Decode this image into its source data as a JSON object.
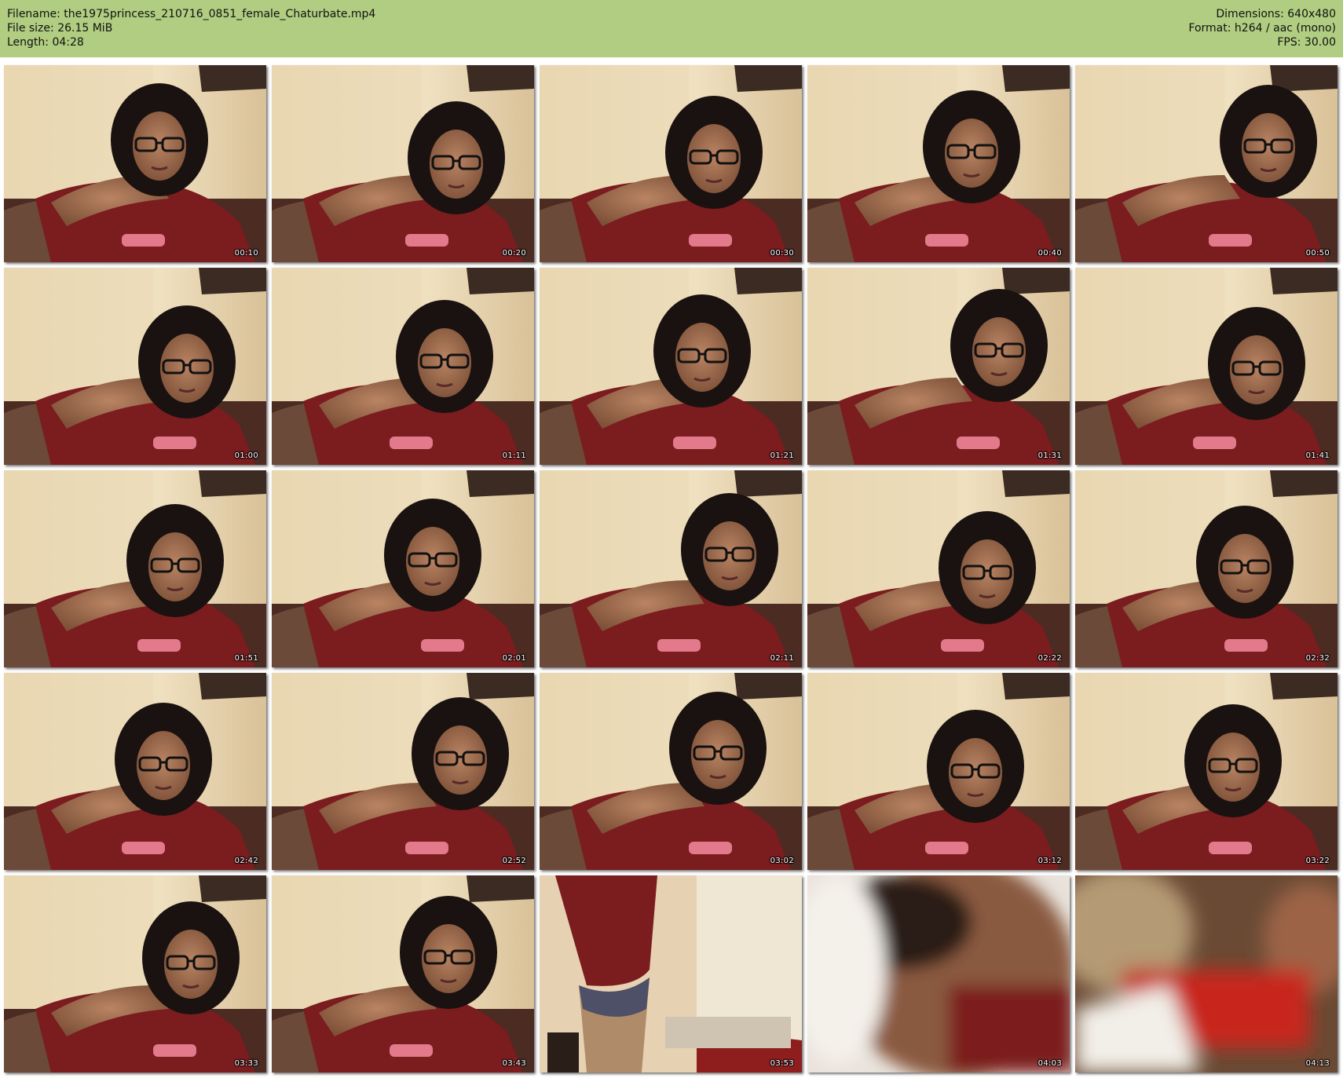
{
  "header": {
    "filename": "Filename: the1975princess_210716_0851_female_Chaturbate.mp4",
    "file_size": "File size: 26.15 MiB",
    "length": "Length: 04:28",
    "dimensions": "Dimensions: 640x480",
    "format": "Format: h264 / aac (mono)",
    "fps": "FPS: 30.00",
    "background_color": "#b0cd81"
  },
  "thumbnails": [
    {
      "timestamp": "00:10",
      "scene": "pose"
    },
    {
      "timestamp": "00:20",
      "scene": "pose"
    },
    {
      "timestamp": "00:30",
      "scene": "pose"
    },
    {
      "timestamp": "00:40",
      "scene": "pose"
    },
    {
      "timestamp": "00:50",
      "scene": "pose"
    },
    {
      "timestamp": "01:00",
      "scene": "pose"
    },
    {
      "timestamp": "01:11",
      "scene": "pose"
    },
    {
      "timestamp": "01:21",
      "scene": "pose"
    },
    {
      "timestamp": "01:31",
      "scene": "pose"
    },
    {
      "timestamp": "01:41",
      "scene": "pose"
    },
    {
      "timestamp": "01:51",
      "scene": "pose"
    },
    {
      "timestamp": "02:01",
      "scene": "pose"
    },
    {
      "timestamp": "02:11",
      "scene": "pose"
    },
    {
      "timestamp": "02:22",
      "scene": "pose"
    },
    {
      "timestamp": "02:32",
      "scene": "pose"
    },
    {
      "timestamp": "02:42",
      "scene": "pose"
    },
    {
      "timestamp": "02:52",
      "scene": "pose"
    },
    {
      "timestamp": "03:02",
      "scene": "pose"
    },
    {
      "timestamp": "03:12",
      "scene": "pose"
    },
    {
      "timestamp": "03:22",
      "scene": "pose"
    },
    {
      "timestamp": "03:33",
      "scene": "pose"
    },
    {
      "timestamp": "03:43",
      "scene": "pose"
    },
    {
      "timestamp": "03:53",
      "scene": "standing"
    },
    {
      "timestamp": "04:03",
      "scene": "blur-light"
    },
    {
      "timestamp": "04:13",
      "scene": "blur-red"
    }
  ]
}
